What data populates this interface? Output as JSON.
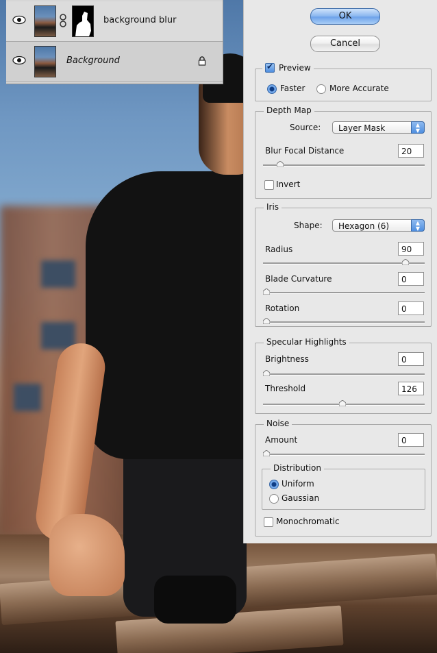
{
  "layers": {
    "items": [
      {
        "name": "background blur",
        "visible": true,
        "has_mask": true
      },
      {
        "name": "Background",
        "visible": true,
        "locked": true
      }
    ]
  },
  "dialog": {
    "buttons": {
      "ok": "OK",
      "cancel": "Cancel"
    },
    "preview": {
      "label": "Preview",
      "checked": true,
      "faster": "Faster",
      "more_accurate": "More Accurate",
      "mode": "Faster"
    },
    "depth_map": {
      "legend": "Depth Map",
      "source_label": "Source:",
      "source_value": "Layer Mask",
      "blur_focal_label": "Blur Focal Distance",
      "blur_focal_value": "20",
      "invert_label": "Invert",
      "invert_checked": false,
      "slider_fraction": 0.09
    },
    "iris": {
      "legend": "Iris",
      "shape_label": "Shape:",
      "shape_value": "Hexagon (6)",
      "radius_label": "Radius",
      "radius_value": "90",
      "radius_fraction": 0.9,
      "curvature_label": "Blade Curvature",
      "curvature_value": "0",
      "curvature_fraction": 0,
      "rotation_label": "Rotation",
      "rotation_value": "0",
      "rotation_fraction": 0
    },
    "specular": {
      "legend": "Specular Highlights",
      "brightness_label": "Brightness",
      "brightness_value": "0",
      "brightness_fraction": 0,
      "threshold_label": "Threshold",
      "threshold_value": "126",
      "threshold_fraction": 0.49
    },
    "noise": {
      "legend": "Noise",
      "amount_label": "Amount",
      "amount_value": "0",
      "amount_fraction": 0,
      "distribution_legend": "Distribution",
      "uniform": "Uniform",
      "gaussian": "Gaussian",
      "distribution": "Uniform",
      "monochromatic_label": "Monochromatic",
      "monochromatic_checked": false
    }
  },
  "colors": {
    "accent": "#4f8fe0",
    "panel": "#e8e8e8"
  }
}
